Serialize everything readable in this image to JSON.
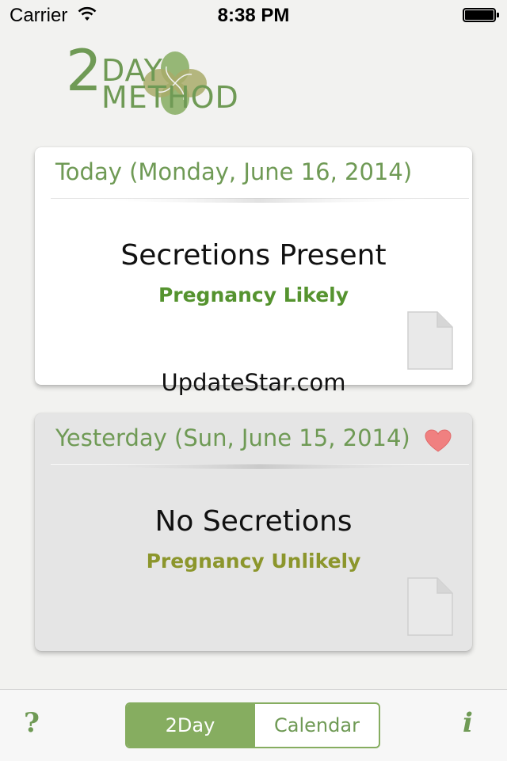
{
  "status_bar": {
    "carrier": "Carrier",
    "time": "8:38 PM"
  },
  "logo": {
    "number": "2",
    "line1": "DAY",
    "line2": "METHOD"
  },
  "today_card": {
    "header": "Today (Monday, June 16, 2014)",
    "title": "Secretions Present",
    "status": "Pregnancy Likely"
  },
  "yesterday_card": {
    "header": "Yesterday (Sun, June 15, 2014)",
    "title": "No Secretions",
    "status": "Pregnancy Unlikely"
  },
  "watermark": "UpdateStar.com",
  "tab_bar": {
    "help": "?",
    "info": "i",
    "segments": [
      "2Day",
      "Calendar"
    ],
    "selected": "2Day"
  },
  "colors": {
    "accent": "#6f9a55",
    "segment_active": "#86ad60",
    "likely": "#55932f",
    "unlikely": "#8c962c",
    "heart": "#f08080"
  }
}
